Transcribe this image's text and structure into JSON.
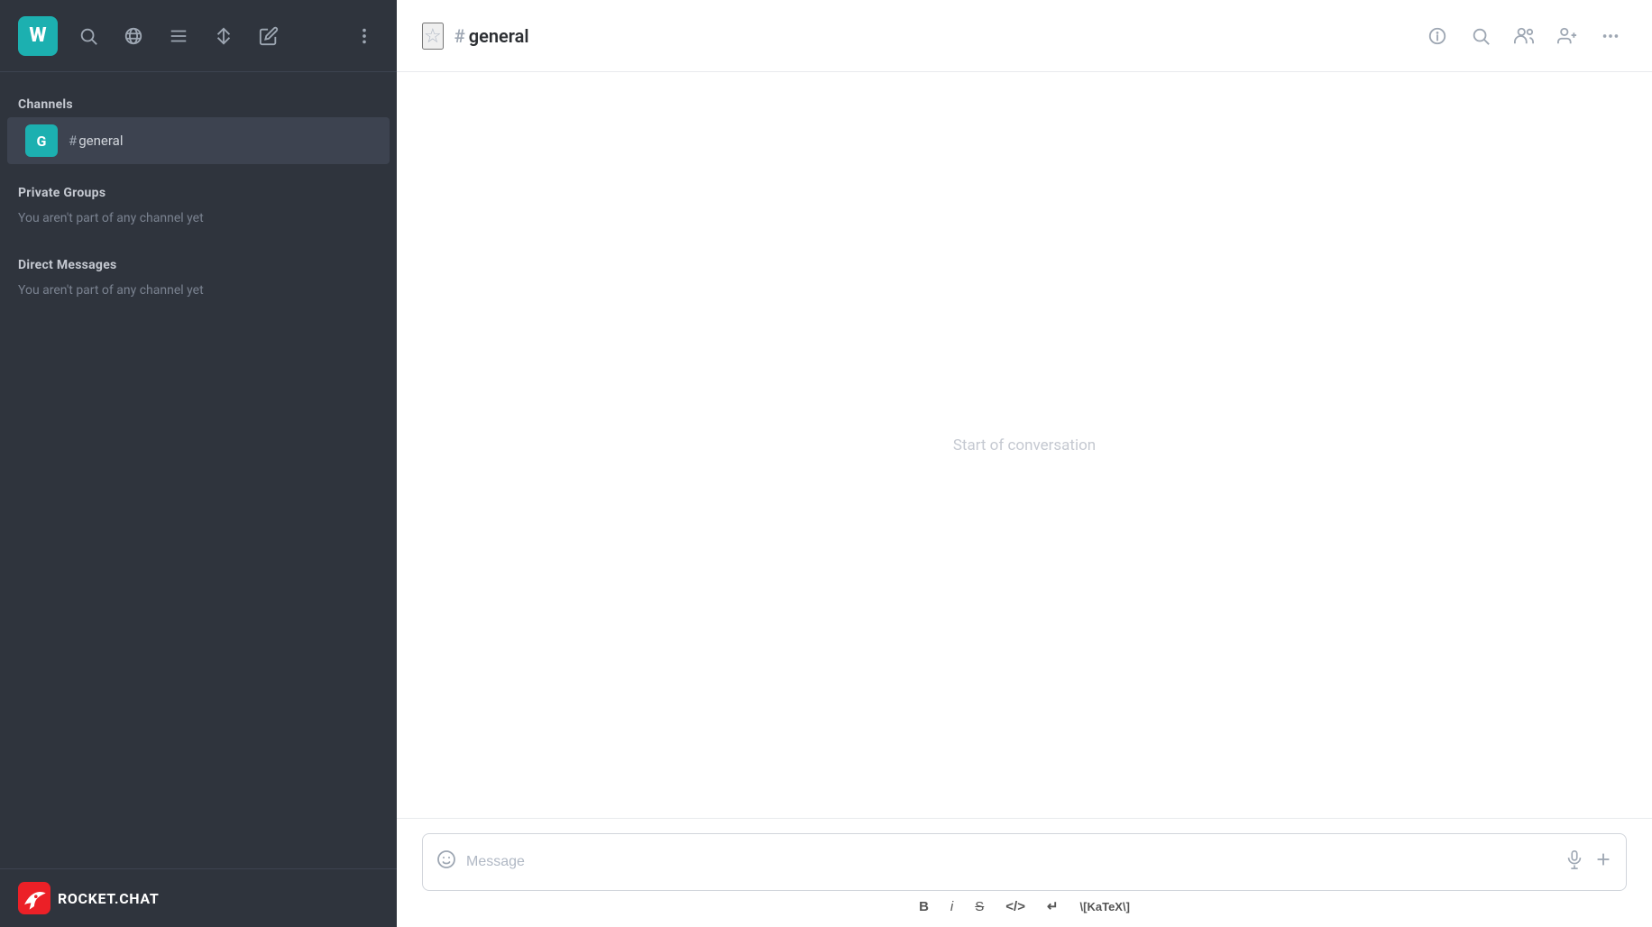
{
  "sidebar": {
    "logo_letter": "W",
    "channels_section": "Channels",
    "general_channel": "general",
    "private_groups_section": "Private Groups",
    "private_groups_empty": "You aren't part of any channel yet",
    "direct_messages_section": "Direct Messages",
    "direct_messages_empty": "You aren't part of any channel yet",
    "footer_brand": "ROCKET.CHAT"
  },
  "header": {
    "channel_name": "general",
    "star_icon": "star-icon",
    "info_icon": "info-icon",
    "search_icon": "header-search-icon",
    "members_icon": "members-icon",
    "add_user_icon": "add-user-icon",
    "more_icon": "more-icon"
  },
  "conversation": {
    "start_text": "Start of conversation"
  },
  "message_input": {
    "placeholder": "Message",
    "emoji_icon": "emoji-icon",
    "mic_icon": "mic-icon",
    "plus_icon": "plus-icon"
  },
  "toolbar": {
    "bold": "B",
    "italic": "i",
    "strikethrough": "S",
    "code": "</>",
    "return": "↵",
    "katex": "\\[KaTeX\\]"
  }
}
